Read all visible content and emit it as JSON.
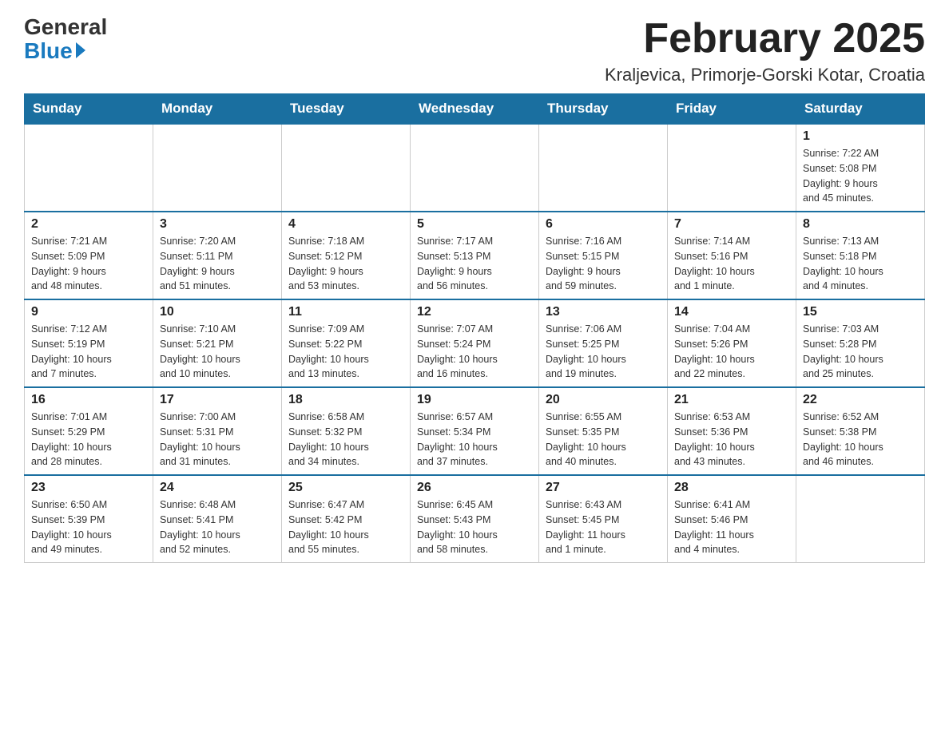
{
  "header": {
    "logo_general": "General",
    "logo_blue": "Blue",
    "month_title": "February 2025",
    "location": "Kraljevica, Primorje-Gorski Kotar, Croatia"
  },
  "weekdays": [
    "Sunday",
    "Monday",
    "Tuesday",
    "Wednesday",
    "Thursday",
    "Friday",
    "Saturday"
  ],
  "weeks": [
    [
      {
        "day": "",
        "info": ""
      },
      {
        "day": "",
        "info": ""
      },
      {
        "day": "",
        "info": ""
      },
      {
        "day": "",
        "info": ""
      },
      {
        "day": "",
        "info": ""
      },
      {
        "day": "",
        "info": ""
      },
      {
        "day": "1",
        "info": "Sunrise: 7:22 AM\nSunset: 5:08 PM\nDaylight: 9 hours\nand 45 minutes."
      }
    ],
    [
      {
        "day": "2",
        "info": "Sunrise: 7:21 AM\nSunset: 5:09 PM\nDaylight: 9 hours\nand 48 minutes."
      },
      {
        "day": "3",
        "info": "Sunrise: 7:20 AM\nSunset: 5:11 PM\nDaylight: 9 hours\nand 51 minutes."
      },
      {
        "day": "4",
        "info": "Sunrise: 7:18 AM\nSunset: 5:12 PM\nDaylight: 9 hours\nand 53 minutes."
      },
      {
        "day": "5",
        "info": "Sunrise: 7:17 AM\nSunset: 5:13 PM\nDaylight: 9 hours\nand 56 minutes."
      },
      {
        "day": "6",
        "info": "Sunrise: 7:16 AM\nSunset: 5:15 PM\nDaylight: 9 hours\nand 59 minutes."
      },
      {
        "day": "7",
        "info": "Sunrise: 7:14 AM\nSunset: 5:16 PM\nDaylight: 10 hours\nand 1 minute."
      },
      {
        "day": "8",
        "info": "Sunrise: 7:13 AM\nSunset: 5:18 PM\nDaylight: 10 hours\nand 4 minutes."
      }
    ],
    [
      {
        "day": "9",
        "info": "Sunrise: 7:12 AM\nSunset: 5:19 PM\nDaylight: 10 hours\nand 7 minutes."
      },
      {
        "day": "10",
        "info": "Sunrise: 7:10 AM\nSunset: 5:21 PM\nDaylight: 10 hours\nand 10 minutes."
      },
      {
        "day": "11",
        "info": "Sunrise: 7:09 AM\nSunset: 5:22 PM\nDaylight: 10 hours\nand 13 minutes."
      },
      {
        "day": "12",
        "info": "Sunrise: 7:07 AM\nSunset: 5:24 PM\nDaylight: 10 hours\nand 16 minutes."
      },
      {
        "day": "13",
        "info": "Sunrise: 7:06 AM\nSunset: 5:25 PM\nDaylight: 10 hours\nand 19 minutes."
      },
      {
        "day": "14",
        "info": "Sunrise: 7:04 AM\nSunset: 5:26 PM\nDaylight: 10 hours\nand 22 minutes."
      },
      {
        "day": "15",
        "info": "Sunrise: 7:03 AM\nSunset: 5:28 PM\nDaylight: 10 hours\nand 25 minutes."
      }
    ],
    [
      {
        "day": "16",
        "info": "Sunrise: 7:01 AM\nSunset: 5:29 PM\nDaylight: 10 hours\nand 28 minutes."
      },
      {
        "day": "17",
        "info": "Sunrise: 7:00 AM\nSunset: 5:31 PM\nDaylight: 10 hours\nand 31 minutes."
      },
      {
        "day": "18",
        "info": "Sunrise: 6:58 AM\nSunset: 5:32 PM\nDaylight: 10 hours\nand 34 minutes."
      },
      {
        "day": "19",
        "info": "Sunrise: 6:57 AM\nSunset: 5:34 PM\nDaylight: 10 hours\nand 37 minutes."
      },
      {
        "day": "20",
        "info": "Sunrise: 6:55 AM\nSunset: 5:35 PM\nDaylight: 10 hours\nand 40 minutes."
      },
      {
        "day": "21",
        "info": "Sunrise: 6:53 AM\nSunset: 5:36 PM\nDaylight: 10 hours\nand 43 minutes."
      },
      {
        "day": "22",
        "info": "Sunrise: 6:52 AM\nSunset: 5:38 PM\nDaylight: 10 hours\nand 46 minutes."
      }
    ],
    [
      {
        "day": "23",
        "info": "Sunrise: 6:50 AM\nSunset: 5:39 PM\nDaylight: 10 hours\nand 49 minutes."
      },
      {
        "day": "24",
        "info": "Sunrise: 6:48 AM\nSunset: 5:41 PM\nDaylight: 10 hours\nand 52 minutes."
      },
      {
        "day": "25",
        "info": "Sunrise: 6:47 AM\nSunset: 5:42 PM\nDaylight: 10 hours\nand 55 minutes."
      },
      {
        "day": "26",
        "info": "Sunrise: 6:45 AM\nSunset: 5:43 PM\nDaylight: 10 hours\nand 58 minutes."
      },
      {
        "day": "27",
        "info": "Sunrise: 6:43 AM\nSunset: 5:45 PM\nDaylight: 11 hours\nand 1 minute."
      },
      {
        "day": "28",
        "info": "Sunrise: 6:41 AM\nSunset: 5:46 PM\nDaylight: 11 hours\nand 4 minutes."
      },
      {
        "day": "",
        "info": ""
      }
    ]
  ]
}
